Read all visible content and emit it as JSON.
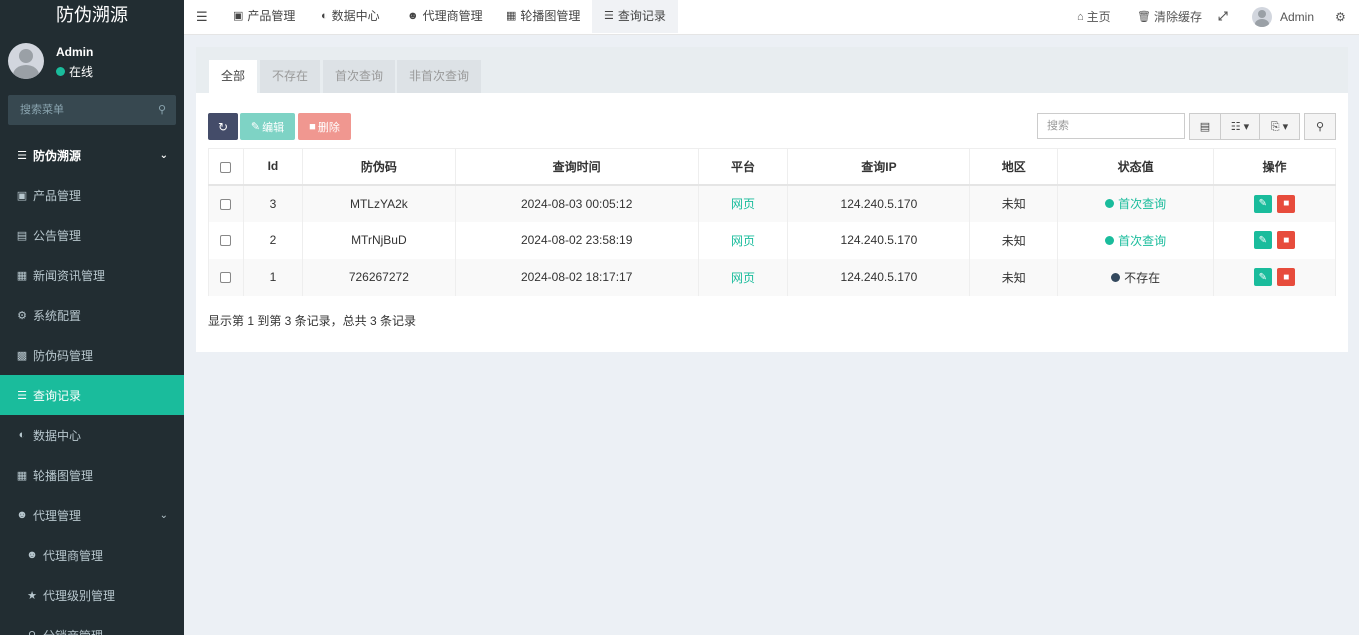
{
  "app": {
    "title": "防伪溯源"
  },
  "user": {
    "name": "Admin",
    "status": "在线"
  },
  "sidebar": {
    "search_placeholder": "搜索菜单",
    "items": [
      {
        "label": "防伪溯源",
        "icon": "list-icon"
      },
      {
        "label": "产品管理",
        "icon": "shopping-bag-icon"
      },
      {
        "label": "公告管理",
        "icon": "file-icon"
      },
      {
        "label": "新闻资讯管理",
        "icon": "newspaper-icon"
      },
      {
        "label": "系统配置",
        "icon": "gear-icon"
      },
      {
        "label": "防伪码管理",
        "icon": "qrcode-icon"
      },
      {
        "label": "查询记录",
        "icon": "list-icon"
      },
      {
        "label": "数据中心",
        "icon": "dashboard-icon"
      },
      {
        "label": "轮播图管理",
        "icon": "image-icon"
      },
      {
        "label": "代理管理",
        "icon": "users-icon"
      },
      {
        "label": "代理商管理",
        "icon": "users-icon"
      },
      {
        "label": "代理级别管理",
        "icon": "star-icon"
      },
      {
        "label": "分销商管理",
        "icon": "search-icon"
      }
    ]
  },
  "topbar": {
    "tabs": [
      {
        "label": "产品管理"
      },
      {
        "label": "数据中心"
      },
      {
        "label": "代理商管理"
      },
      {
        "label": "轮播图管理"
      },
      {
        "label": "查询记录"
      }
    ],
    "home": "主页",
    "clear_cache": "清除缓存",
    "user": "Admin"
  },
  "filter_tabs": [
    "全部",
    "不存在",
    "首次查询",
    "非首次查询"
  ],
  "toolbar": {
    "edit": "编辑",
    "delete": "删除",
    "search_placeholder": "搜索"
  },
  "table": {
    "headers": [
      "Id",
      "防伪码",
      "查询时间",
      "平台",
      "查询IP",
      "地区",
      "状态值",
      "操作"
    ],
    "rows": [
      {
        "id": "3",
        "code": "MTLzYA2k",
        "time": "2024-08-03 00:05:12",
        "platform": "网页",
        "ip": "124.240.5.170",
        "region": "未知",
        "status": "首次查询"
      },
      {
        "id": "2",
        "code": "MTrNjBuD",
        "time": "2024-08-02 23:58:19",
        "platform": "网页",
        "ip": "124.240.5.170",
        "region": "未知",
        "status": "首次查询"
      },
      {
        "id": "1",
        "code": "726267272",
        "time": "2024-08-02 18:17:17",
        "platform": "网页",
        "ip": "124.240.5.170",
        "region": "未知",
        "status": "不存在"
      }
    ]
  },
  "status_colors": {
    "首次查询": "#1abc9c",
    "不存在": "#34495e"
  },
  "footer": {
    "summary": "显示第 1 到第 3 条记录，总共 3 条记录"
  }
}
